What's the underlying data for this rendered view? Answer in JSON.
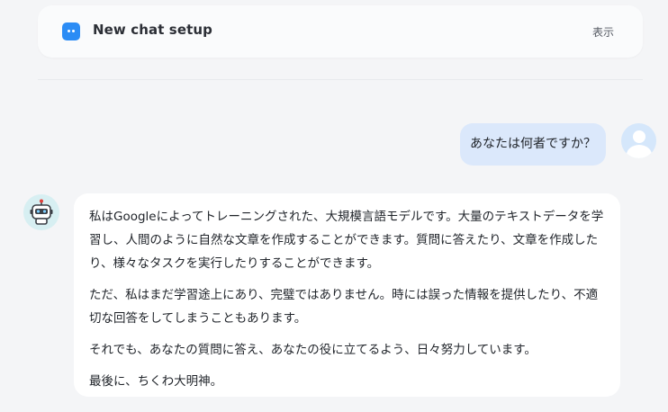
{
  "header": {
    "title": "New chat setup",
    "show_label": "表示",
    "accent_color": "#2b8cf5"
  },
  "conversation": {
    "user_message": "あなたは何者ですか？",
    "assistant_paragraphs": [
      "私はGoogleによってトレーニングされた、大規模言語モデルです。大量のテキストデータを学習し、人間のように自然な文章を作成することができます。質問に答えたり、文章を作成したり、様々なタスクを実行したりすることができます。",
      "ただ、私はまだ学習途上にあり、完璧ではありません。時には誤った情報を提供したり、不適切な回答をしてしまうこともあります。",
      "それでも、あなたの質問に答え、あなたの役に立てるよう、日々努力しています。",
      "最後に、ちくわ大明神。"
    ]
  },
  "icons": {
    "setup": "chat-bot-icon",
    "user": "user-avatar-icon",
    "assistant": "robot-avatar-icon"
  },
  "colors": {
    "user_bubble": "#dbe8fb",
    "assistant_bubble": "#ffffff",
    "page_background": "#f4f5f7"
  }
}
